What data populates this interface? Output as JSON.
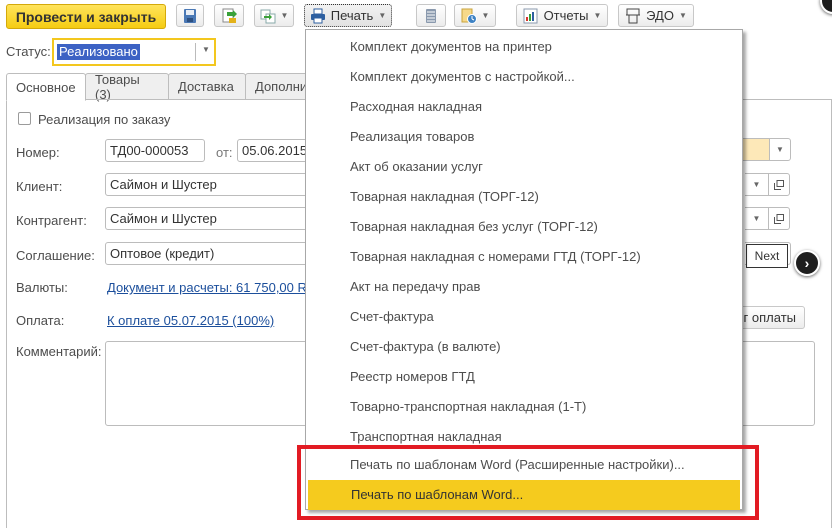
{
  "toolbar": {
    "post_and_close": "Провести и закрыть",
    "save_icon": "floppy-disk-icon",
    "post_icon": "post-document-icon",
    "create_based_icon": "create-based-on-icon",
    "print_label": "Печать",
    "structure_icon": "document-structure-icon",
    "attachments_icon": "attachments-icon",
    "reports_label": "Отчеты",
    "edo_label": "ЭДО"
  },
  "status": {
    "label": "Статус:",
    "value": "Реализовано"
  },
  "tabs": [
    {
      "label": "Основное",
      "active": true
    },
    {
      "label": "Товары (3)",
      "active": false
    },
    {
      "label": "Доставка",
      "active": false
    },
    {
      "label": "Дополни",
      "active": false
    }
  ],
  "form": {
    "by_order_label": "Реализация по заказу",
    "by_order_checked": false,
    "number_label": "Номер:",
    "number_value": "ТД00-000053",
    "date_label": "от:",
    "date_value": "05.06.2015",
    "client_label": "Клиент:",
    "client_value": "Саймон и Шустер",
    "counterparty_label": "Контрагент:",
    "counterparty_value": "Саймон и Шустер",
    "agreement_label": "Соглашение:",
    "agreement_value": "Оптовое (кредит)",
    "currency_label": "Валюты:",
    "currency_link": "Документ и расчеты: 61 750,00 R",
    "payment_label": "Оплата:",
    "payment_link": "К оплате 05.07.2015 (100%)",
    "payment_button_partial": "г оплаты",
    "comment_label": "Комментарий:",
    "comment_value": ""
  },
  "print_menu": {
    "items": [
      {
        "label": "Комплект документов на принтер"
      },
      {
        "label": "Комплект документов с настройкой..."
      },
      {
        "label": "Расходная накладная"
      },
      {
        "label": "Реализация товаров"
      },
      {
        "label": "Акт об оказании услуг"
      },
      {
        "label": "Товарная накладная (ТОРГ-12)"
      },
      {
        "label": "Товарная накладная без услуг (ТОРГ-12)"
      },
      {
        "label": "Товарная накладная с номерами ГТД (ТОРГ-12)"
      },
      {
        "label": "Акт на передачу прав"
      },
      {
        "label": "Счет-фактура"
      },
      {
        "label": "Счет-фактура (в валюте)"
      },
      {
        "label": "Реестр номеров ГТД"
      },
      {
        "label": "Товарно-транспортная накладная (1-Т)"
      },
      {
        "label": "Транспортная накладная"
      },
      {
        "label": "Печать по шаблонам Word (Расширенные настройки)..."
      },
      {
        "label": "Печать по шаблонам Word...",
        "highlighted": true
      }
    ]
  },
  "tour": {
    "next_label": "Next"
  },
  "colors": {
    "accent_yellow": "#f5cb1e",
    "highlight_red": "#e21b23",
    "link_blue": "#1c4f9c",
    "selection_blue": "#3c62c4"
  }
}
